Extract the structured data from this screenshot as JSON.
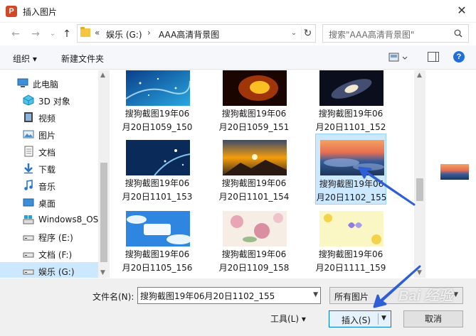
{
  "window": {
    "title": "插入图片",
    "app_icon": "powerpoint-icon",
    "app_icon_letter": "P"
  },
  "address": {
    "breadcrumbs": [
      "«",
      "娱乐 (G:)",
      "›",
      "AAA高清背景图"
    ]
  },
  "search": {
    "placeholder": "搜索\"AAA高清背景图\""
  },
  "toolbar": {
    "organize_label": "组织 ▾",
    "new_folder_label": "新建文件夹",
    "help_label": "?"
  },
  "sidebar": {
    "items": [
      {
        "label": "此电脑",
        "icon": "computer-icon"
      },
      {
        "label": "3D 对象",
        "icon": "3d-objects-icon"
      },
      {
        "label": "视频",
        "icon": "video-icon"
      },
      {
        "label": "图片",
        "icon": "pictures-icon"
      },
      {
        "label": "文档",
        "icon": "documents-icon"
      },
      {
        "label": "下载",
        "icon": "download-icon"
      },
      {
        "label": "音乐",
        "icon": "music-icon"
      },
      {
        "label": "桌面",
        "icon": "desktop-icon"
      },
      {
        "label": "Windows8_OS",
        "icon": "drive-icon"
      },
      {
        "label": "程序 (E:)",
        "icon": "drive-icon"
      },
      {
        "label": "文档 (F:)",
        "icon": "drive-icon"
      },
      {
        "label": "娱乐 (G:)",
        "icon": "drive-icon",
        "selected": true
      }
    ]
  },
  "files": [
    {
      "line1": "搜狗截图19年06",
      "line2": "月20日1059_150",
      "thumb": "blue-sparkle"
    },
    {
      "line1": "搜狗截图19年06",
      "line2": "月20日1059_151",
      "thumb": "fire"
    },
    {
      "line1": "搜狗截图19年06",
      "line2": "月20日1101_152",
      "thumb": "galaxy"
    },
    {
      "line1": "搜狗截图19年06",
      "line2": "月20日1101_153",
      "thumb": "blue-bokeh"
    },
    {
      "line1": "搜狗截图19年06",
      "line2": "月20日1101_154",
      "thumb": "sunrise-mountain"
    },
    {
      "line1": "搜狗截图19年06",
      "line2": "月20日1102_155",
      "thumb": "sunset-clouds",
      "selected": true
    },
    {
      "line1": "搜狗截图19年06",
      "line2": "月20日1105_156",
      "thumb": "blue-sky-frame"
    },
    {
      "line1": "搜狗截图19年06",
      "line2": "月20日1109_158",
      "thumb": "flowers"
    },
    {
      "line1": "搜狗截图19年06",
      "line2": "月20日1111_159",
      "thumb": "butterflies"
    }
  ],
  "bottom": {
    "filename_label": "文件名(N):",
    "filename_value": "搜狗截图19年06月20日1102_155",
    "filetype_value": "所有图片",
    "tools_label": "工具(L)   ▾",
    "insert_label": "插入(S)",
    "cancel_label": "取消"
  },
  "watermark": "Bai 经验",
  "colors": {
    "accent": "#0078d7",
    "selection": "#cce8ff",
    "annotation_arrow": "#2f5fd6"
  }
}
